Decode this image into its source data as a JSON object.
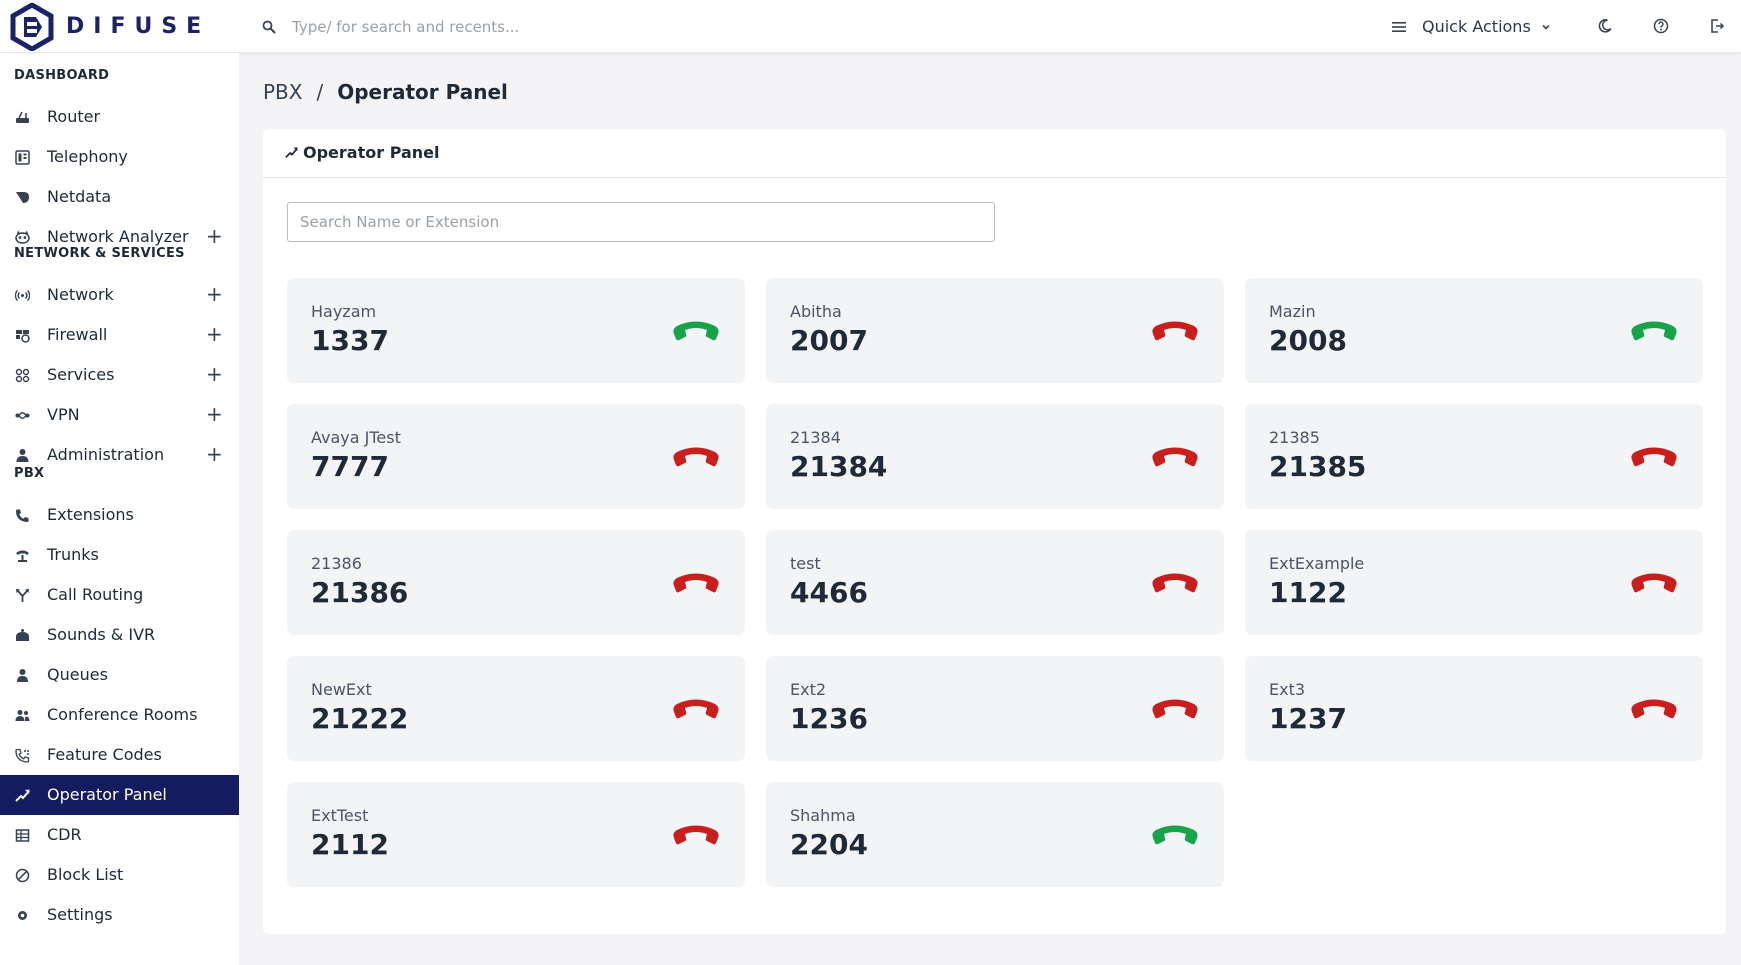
{
  "brand": {
    "name": "DIFUSE"
  },
  "topbar": {
    "search_placeholder": "Type/ for search and recents...",
    "quick_actions_label": "Quick Actions"
  },
  "sidebar": {
    "sections": [
      {
        "title": "DASHBOARD"
      },
      {
        "title": "NETWORK & SERVICES"
      },
      {
        "title": "PBX"
      }
    ],
    "items": [
      {
        "label": "Router",
        "icon": "router-icon"
      },
      {
        "label": "Telephony",
        "icon": "telephony-icon"
      },
      {
        "label": "Netdata",
        "icon": "netdata-icon"
      },
      {
        "label": "Network Analyzer",
        "icon": "network-analyzer-icon",
        "expandable": true
      },
      {
        "label": "Network",
        "icon": "network-icon",
        "expandable": true
      },
      {
        "label": "Firewall",
        "icon": "firewall-icon",
        "expandable": true
      },
      {
        "label": "Services",
        "icon": "services-icon",
        "expandable": true
      },
      {
        "label": "VPN",
        "icon": "vpn-icon",
        "expandable": true
      },
      {
        "label": "Administration",
        "icon": "administration-icon",
        "expandable": true
      },
      {
        "label": "Extensions",
        "icon": "phone-icon"
      },
      {
        "label": "Trunks",
        "icon": "trunks-icon"
      },
      {
        "label": "Call Routing",
        "icon": "call-routing-icon"
      },
      {
        "label": "Sounds & IVR",
        "icon": "sounds-icon"
      },
      {
        "label": "Queues",
        "icon": "queues-icon"
      },
      {
        "label": "Conference Rooms",
        "icon": "conference-icon"
      },
      {
        "label": "Feature Codes",
        "icon": "feature-codes-icon"
      },
      {
        "label": "Operator Panel",
        "icon": "operator-panel-icon",
        "active": true
      },
      {
        "label": "CDR",
        "icon": "cdr-icon"
      },
      {
        "label": "Block List",
        "icon": "block-icon"
      },
      {
        "label": "Settings",
        "icon": "settings-icon"
      }
    ]
  },
  "breadcrumb": {
    "parent": "PBX",
    "separator": "/",
    "current": "Operator Panel"
  },
  "panel": {
    "title": "Operator Panel",
    "search_placeholder": "Search Name or Extension",
    "status_colors": {
      "available": "#16a34a",
      "unavailable": "#c81e1e"
    },
    "extensions": [
      {
        "name": "Hayzam",
        "number": "1337",
        "status": "available"
      },
      {
        "name": "Abitha",
        "number": "2007",
        "status": "unavailable"
      },
      {
        "name": "Mazin",
        "number": "2008",
        "status": "available"
      },
      {
        "name": "Avaya JTest",
        "number": "7777",
        "status": "unavailable"
      },
      {
        "name": "21384",
        "number": "21384",
        "status": "unavailable"
      },
      {
        "name": "21385",
        "number": "21385",
        "status": "unavailable"
      },
      {
        "name": "21386",
        "number": "21386",
        "status": "unavailable"
      },
      {
        "name": "test",
        "number": "4466",
        "status": "unavailable"
      },
      {
        "name": "ExtExample",
        "number": "1122",
        "status": "unavailable"
      },
      {
        "name": "NewExt",
        "number": "21222",
        "status": "unavailable"
      },
      {
        "name": "Ext2",
        "number": "1236",
        "status": "unavailable"
      },
      {
        "name": "Ext3",
        "number": "1237",
        "status": "unavailable"
      },
      {
        "name": "ExtTest",
        "number": "2112",
        "status": "unavailable"
      },
      {
        "name": "Shahma",
        "number": "2204",
        "status": "available"
      }
    ]
  }
}
